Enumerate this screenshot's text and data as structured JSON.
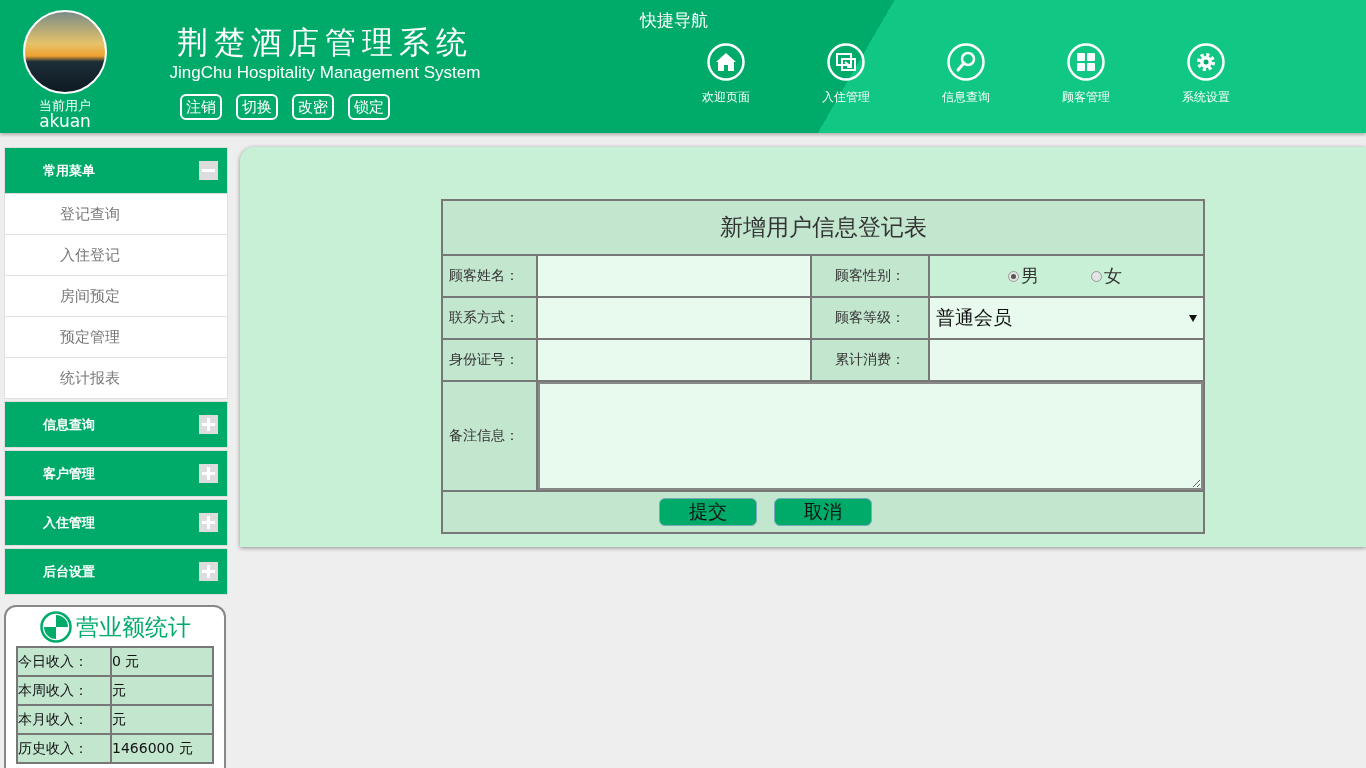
{
  "header": {
    "user": {
      "label": "当前用户",
      "name": "akuan"
    },
    "title": "荆楚酒店管理系统",
    "subtitle": "JingChu Hospitality Management System",
    "actions": [
      "注销",
      "切换",
      "改密",
      "锁定"
    ],
    "quick_nav": {
      "title": "快捷导航",
      "items": [
        {
          "label": "欢迎页面",
          "kind": "home"
        },
        {
          "label": "入住管理",
          "kind": "checkin"
        },
        {
          "label": "信息查询",
          "kind": "search"
        },
        {
          "label": "顾客管理",
          "kind": "grid"
        },
        {
          "label": "系统设置",
          "kind": "settings"
        }
      ]
    }
  },
  "sidebar": {
    "groups": [
      {
        "title": "常用菜单",
        "expanded": true,
        "items": [
          "登记查询",
          "入住登记",
          "房间预定",
          "预定管理",
          "统计报表"
        ]
      },
      {
        "title": "信息查询",
        "expanded": false
      },
      {
        "title": "客户管理",
        "expanded": false
      },
      {
        "title": "入住管理",
        "expanded": false
      },
      {
        "title": "后台设置",
        "expanded": false
      }
    ]
  },
  "revenue": {
    "title": "营业额统计",
    "rows": [
      {
        "label": "今日收入：",
        "value": "0 元"
      },
      {
        "label": "本周收入：",
        "value": "元"
      },
      {
        "label": "本月收入：",
        "value": "元"
      },
      {
        "label": "历史收入：",
        "value": "1466000 元"
      }
    ]
  },
  "form": {
    "title": "新增用户信息登记表",
    "fields": [
      {
        "label": "顾客姓名：",
        "kind": "text"
      },
      {
        "label": "顾客性别：",
        "kind": "radio",
        "options": [
          {
            "label": "男",
            "selected": true
          },
          {
            "label": "女",
            "selected": false
          }
        ]
      },
      {
        "label": "联系方式：",
        "kind": "text"
      },
      {
        "label": "顾客等级：",
        "kind": "select",
        "value": "普通会员"
      },
      {
        "label": "身份证号：",
        "kind": "text"
      },
      {
        "label": "累计消费：",
        "kind": "text"
      },
      {
        "label": "备注信息：",
        "kind": "textarea"
      }
    ],
    "buttons": [
      "提交",
      "取消"
    ]
  }
}
